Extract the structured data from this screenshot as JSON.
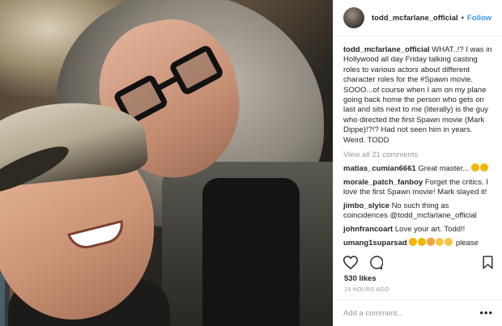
{
  "post": {
    "username": "todd_mcfarlane_official",
    "separator": "•",
    "follow_label": "Follow",
    "photo_alt": "Two men taking a selfie on a plane",
    "caption": {
      "username": "todd_mcfarlane_official",
      "text": "WHAT..!? I was in Hollywood all day Friday talking casting roles to various actors about different character roles for the #Spawn movie. SOOO...of course when I am on my plane going back home the person who gets on last and sits next to me (literally) is the guy who directed the first Spawn movie (Mark Dippe)!?!? Had not seen him in years. Weird. TODD"
    },
    "view_all_label": "View all 21 comments",
    "comments": [
      {
        "username": "matias_cumian6661",
        "text": "Great master...",
        "emojis": [
          "clap",
          "clap"
        ]
      },
      {
        "username": "morale_patch_fanboy",
        "text": "Forget the critics. I love the first Spawn movie! Mark slayed it!",
        "emojis": []
      },
      {
        "username": "jimbo_slyice",
        "text": "No such thing as coincidences @todd_mcfarlane_official",
        "emojis": []
      },
      {
        "username": "johnfrancoart",
        "text": "Love your art. Todd!!",
        "emojis": []
      },
      {
        "username": "umang1suparsad",
        "text": "please",
        "emojis": [
          "clap",
          "clap",
          "heart-eyes",
          "thumbs-up",
          "thumbs-up"
        ]
      }
    ],
    "likes": "530 likes",
    "timestamp": "19 HOURS AGO",
    "add_comment_placeholder": "Add a comment...",
    "more_label": "•••",
    "icons": {
      "like": "heart-icon",
      "comment": "comment-bubble-icon",
      "save": "bookmark-icon"
    },
    "colors": {
      "follow": "#3897f0",
      "muted_text": "#999999",
      "text": "#262626"
    }
  }
}
